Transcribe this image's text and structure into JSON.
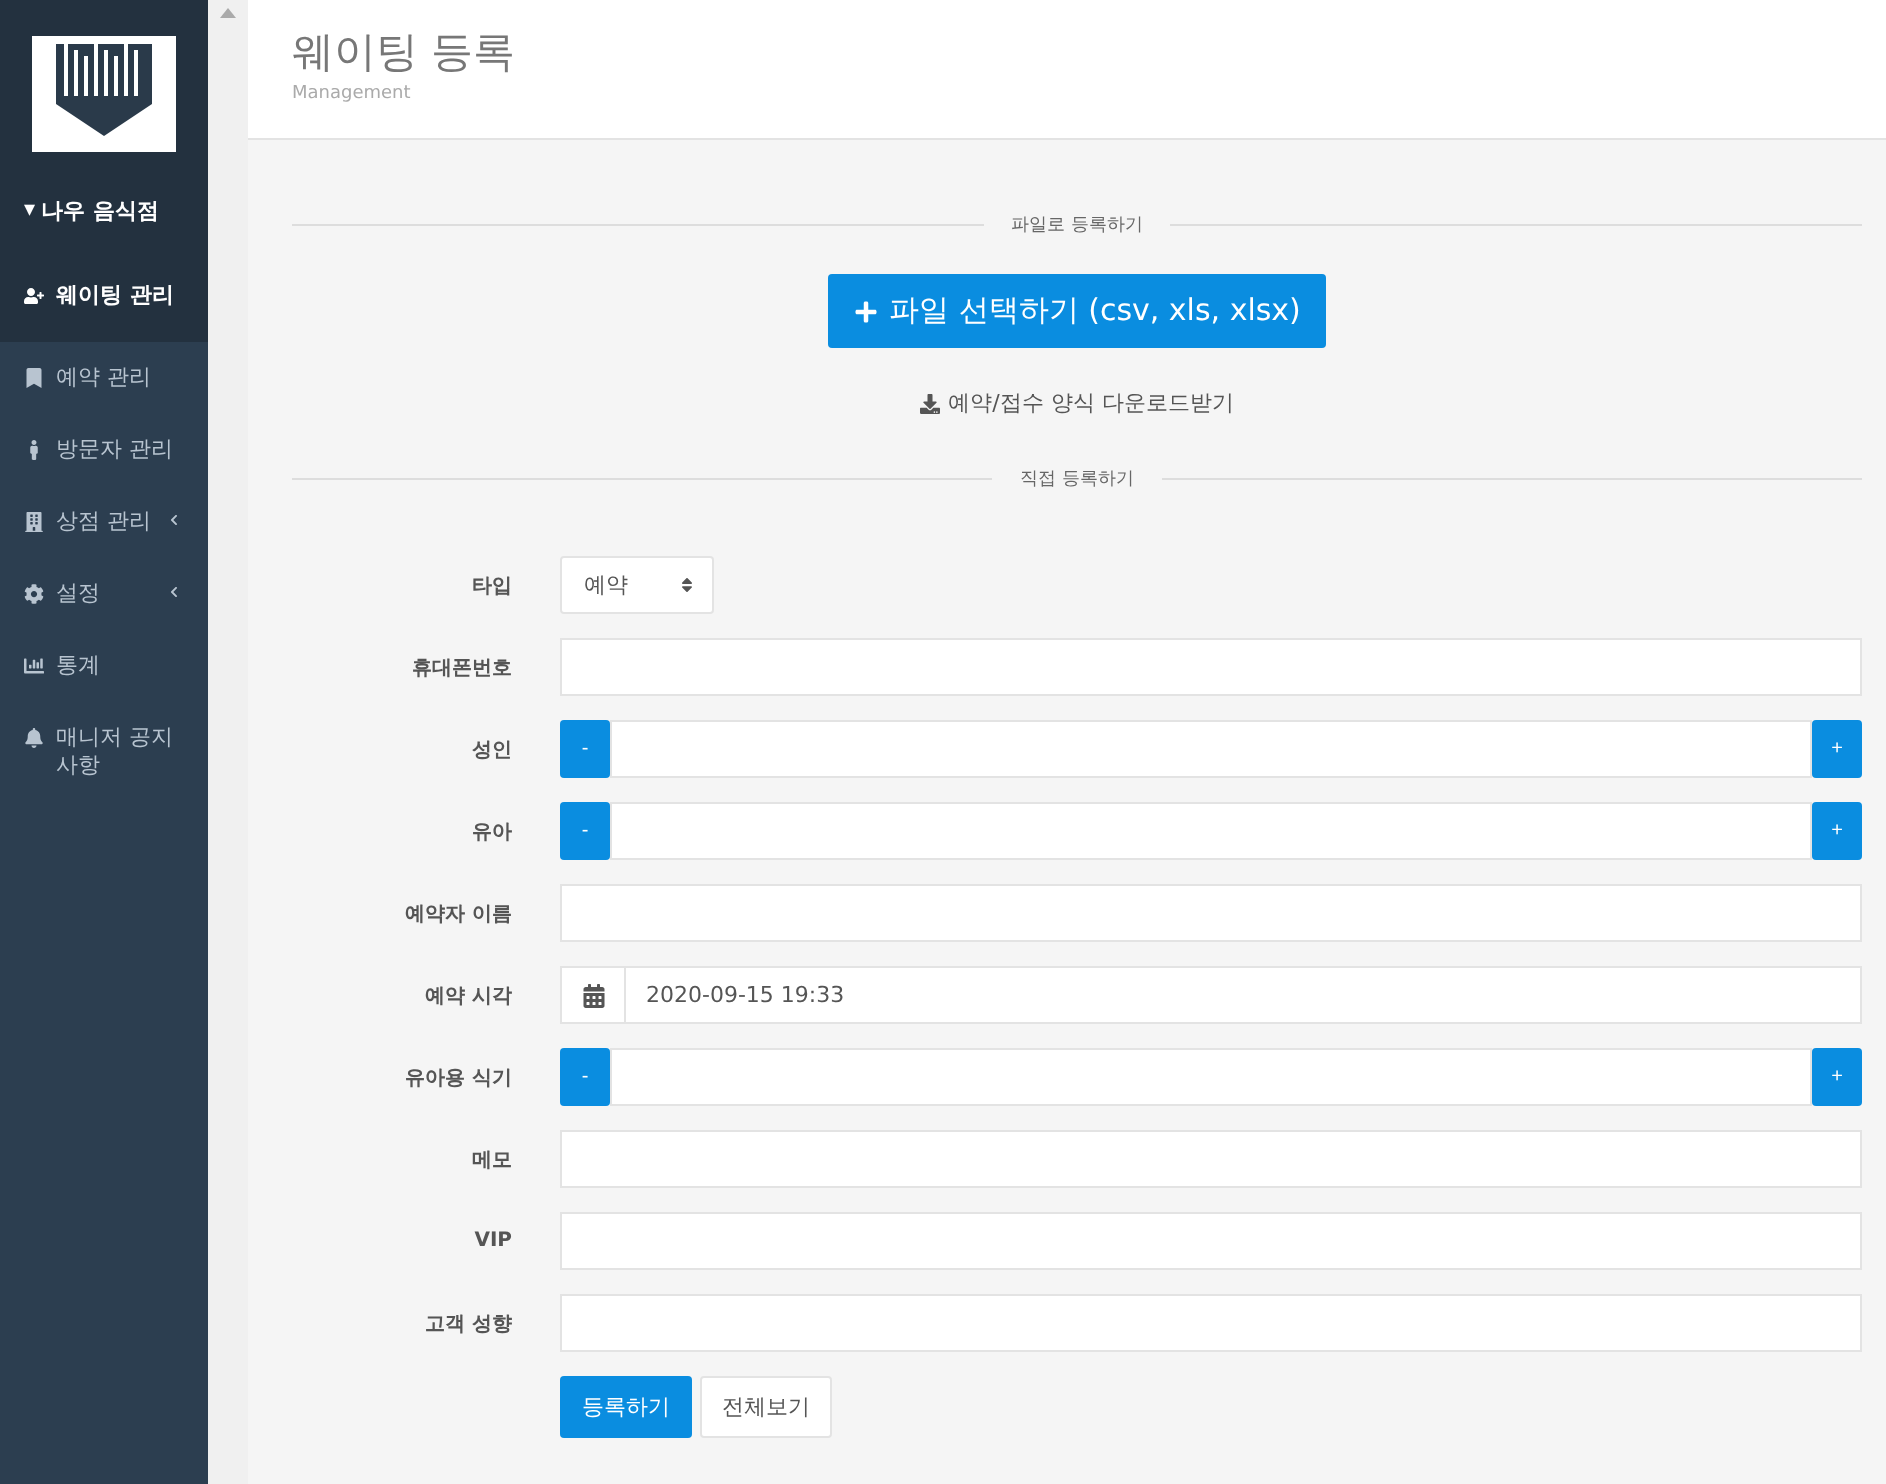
{
  "sidebar": {
    "store": {
      "caret": "▾",
      "name": "나우 음식점"
    },
    "items": [
      {
        "label": "웨이팅 관리",
        "selected": true,
        "submenu": false
      },
      {
        "label": "예약 관리",
        "selected": false,
        "submenu": false
      },
      {
        "label": "방문자 관리",
        "selected": false,
        "submenu": false
      },
      {
        "label": "상점 관리",
        "selected": false,
        "submenu": true
      },
      {
        "label": "설정",
        "selected": false,
        "submenu": true
      },
      {
        "label": "통계",
        "selected": false,
        "submenu": false
      },
      {
        "label": "매니저 공지사항",
        "selected": false,
        "submenu": false
      }
    ]
  },
  "header": {
    "title": "웨이팅 등록",
    "subtitle": "Management"
  },
  "file_section": {
    "divider": "파일로 등록하기",
    "upload_button": "파일 선택하기 (csv, xls, xlsx)",
    "download_link": "예약/접수 양식 다운로드받기"
  },
  "direct_section": {
    "divider": "직접 등록하기"
  },
  "form": [
    {
      "label": "타입",
      "kind": "select",
      "value": "예약"
    },
    {
      "label": "휴대폰번호",
      "kind": "text"
    },
    {
      "label": "성인",
      "kind": "stepper",
      "minus": "-",
      "plus": "+"
    },
    {
      "label": "유아",
      "kind": "stepper",
      "minus": "-",
      "plus": "+"
    },
    {
      "label": "예약자 이름",
      "kind": "text"
    },
    {
      "label": "예약 시각",
      "kind": "date",
      "value": "2020-09-15 19:33"
    },
    {
      "label": "유아용 식기",
      "kind": "stepper",
      "minus": "-",
      "plus": "+"
    },
    {
      "label": "메모",
      "kind": "text"
    },
    {
      "label": "VIP",
      "kind": "text"
    },
    {
      "label": "고객 성향",
      "kind": "text"
    }
  ],
  "buttons": {
    "submit": "등록하기",
    "view_all": "전체보기"
  }
}
